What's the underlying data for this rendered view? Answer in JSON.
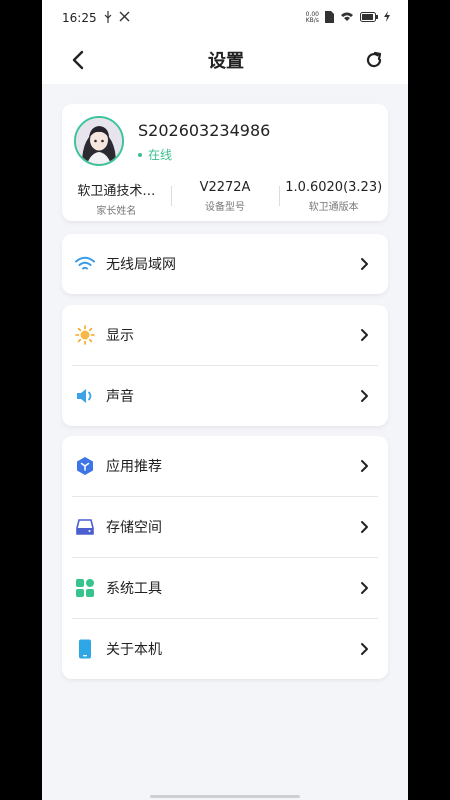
{
  "status_bar": {
    "time": "16:25",
    "net_speed_value": "0.00",
    "net_speed_unit": "KB/s",
    "icons": [
      "usb-icon",
      "tools-icon",
      "sim-icon",
      "wifi-icon",
      "battery-icon",
      "charging-icon"
    ]
  },
  "header": {
    "title": "设置",
    "back_icon": "back-arrow-icon",
    "refresh_icon": "refresh-icon"
  },
  "profile": {
    "account_id": "S202603234986",
    "status": "在线",
    "stats": [
      {
        "value": "软卫通技术…",
        "label": "家长姓名"
      },
      {
        "value": "V2272A",
        "label": "设备型号"
      },
      {
        "value": "1.0.6020(3.23)",
        "label": "软卫通版本"
      }
    ]
  },
  "groups": [
    {
      "items": [
        {
          "label": "无线局域网",
          "icon": "wifi-icon"
        }
      ]
    },
    {
      "items": [
        {
          "label": "显示",
          "icon": "brightness-icon"
        },
        {
          "label": "声音",
          "icon": "speaker-icon"
        }
      ]
    },
    {
      "items": [
        {
          "label": "应用推荐",
          "icon": "app-recommend-icon"
        },
        {
          "label": "存储空间",
          "icon": "storage-icon"
        },
        {
          "label": "系统工具",
          "icon": "system-tools-icon"
        },
        {
          "label": "关于本机",
          "icon": "phone-icon"
        }
      ]
    }
  ],
  "colors": {
    "accent_green": "#3bbf8d",
    "wifi_blue": "#3a9be8",
    "display_orange": "#f5a623",
    "app_blue": "#3d74e8",
    "storage_indigo": "#4b5fd1",
    "tools_green": "#36c48c",
    "phone_cyan": "#2fa6e6"
  }
}
